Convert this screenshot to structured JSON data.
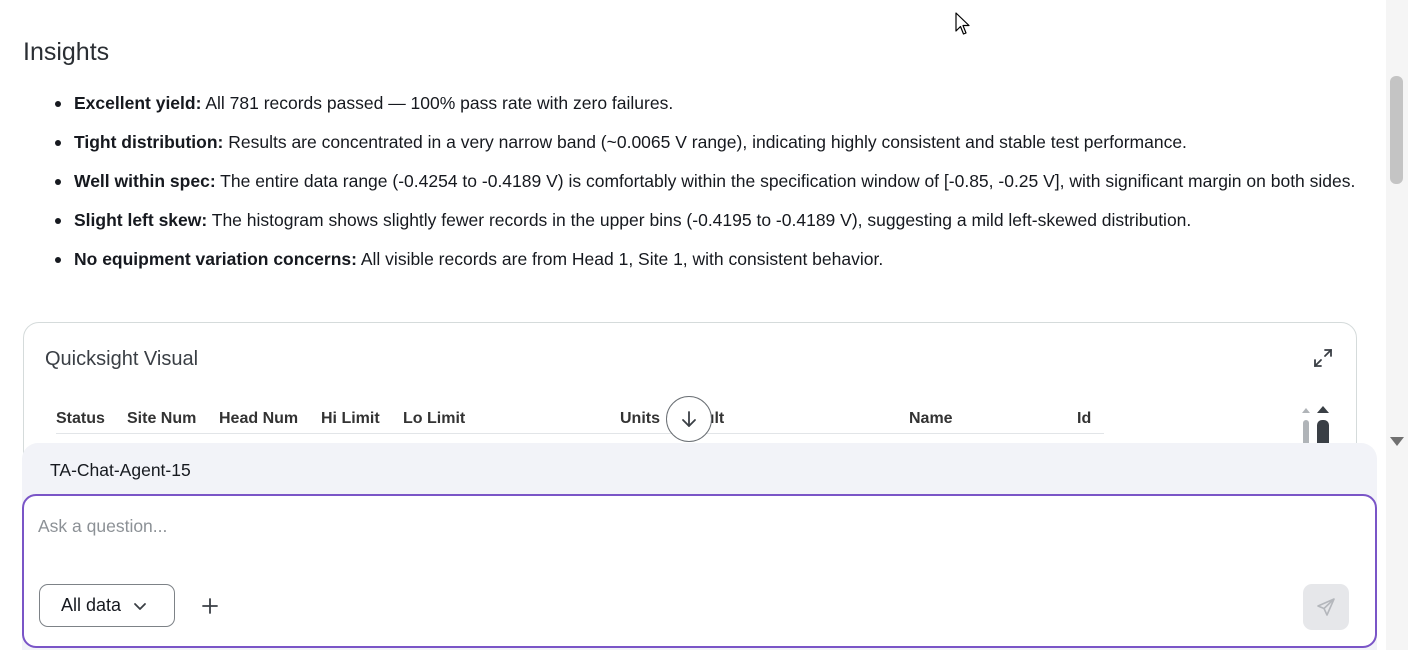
{
  "insights": {
    "title": "Insights",
    "items": [
      {
        "bold": "Excellent yield:",
        "text": " All 781 records passed — 100% pass rate with zero failures."
      },
      {
        "bold": "Tight distribution:",
        "text": " Results are concentrated in a very narrow band (~0.0065 V range), indicating highly consistent and stable test performance."
      },
      {
        "bold": "Well within spec:",
        "text": " The entire data range (-0.4254 to -0.4189 V) is comfortably within the specification window of [-0.85, -0.25 V], with significant margin on both sides."
      },
      {
        "bold": "Slight left skew:",
        "text": " The histogram shows slightly fewer records in the upper bins (-0.4195 to -0.4189 V), suggesting a mild left-skewed distribution."
      },
      {
        "bold": "No equipment variation concerns:",
        "text": " All visible records are from Head 1, Site 1, with consistent behavior."
      }
    ]
  },
  "quicksight": {
    "title": "Quicksight Visual",
    "columns": [
      "Status",
      "Site Num",
      "Head Num",
      "Hi Limit",
      "Lo Limit",
      "Units",
      "ılt",
      "Name",
      "Id"
    ]
  },
  "chat": {
    "agent_name": "TA-Chat-Agent-15",
    "placeholder": "Ask a question...",
    "input_value": "",
    "data_scope": "All data"
  },
  "icons": {
    "expand": "expand-icon",
    "scroll_down": "arrow-down-icon",
    "chevron": "chevron-down-icon",
    "plus": "plus-icon",
    "send": "send-icon"
  },
  "colors": {
    "accent_border": "#7a55c7",
    "panel_bg": "#f2f3f8",
    "text": "#16191f"
  }
}
